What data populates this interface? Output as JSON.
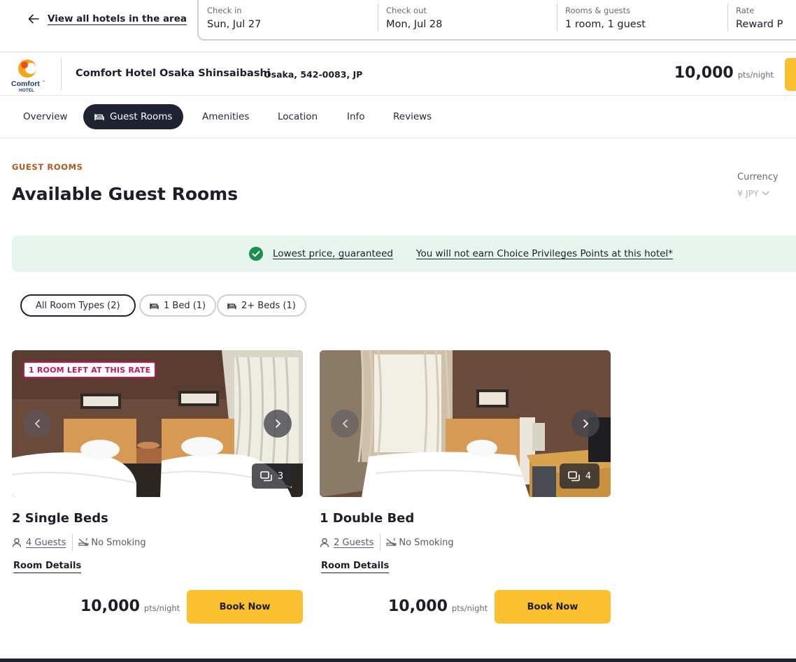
{
  "topbar": {
    "back_label": "View all hotels in the area",
    "fields": [
      {
        "caption": "Check in",
        "value": "Sun, Jul 27"
      },
      {
        "caption": "Check out",
        "value": "Mon, Jul 28"
      },
      {
        "caption": "Rooms & guests",
        "value": "1 room, 1 guest"
      },
      {
        "caption": "Rate",
        "value": "Reward P"
      }
    ]
  },
  "hotel": {
    "logo_text_main": "Comfort",
    "logo_text_tm": "™",
    "logo_text_sub": "HOTEL",
    "name": "Comfort Hotel Osaka Shinsaibashi",
    "address": "Osaka, 542-0083, JP",
    "price": "10,000",
    "price_unit": "pts/night"
  },
  "tabs": [
    {
      "label": "Overview"
    },
    {
      "label": "Guest Rooms",
      "active": true,
      "icon": "bed-icon"
    },
    {
      "label": "Amenities"
    },
    {
      "label": "Location"
    },
    {
      "label": "Info"
    },
    {
      "label": "Reviews"
    }
  ],
  "section": {
    "eyebrow": "GUEST ROOMS",
    "title": "Available Guest Rooms",
    "currency_caption": "Currency",
    "currency_value": "¥ JPY"
  },
  "banner": {
    "link1": "Lowest price, guaranteed",
    "link2": "You will not earn Choice Privileges Points at this hotel*"
  },
  "filters": [
    {
      "label": "All Room Types (2)",
      "active": true
    },
    {
      "label": "1 Bed (1)",
      "icon": "bed-icon"
    },
    {
      "label": "2+ Beds (1)",
      "icon": "bed-icon"
    }
  ],
  "rooms": [
    {
      "badge": "1 ROOM LEFT AT THIS RATE",
      "photo_count": "3",
      "title": "2 Single Beds",
      "guests": "4 Guests",
      "smoking": "No Smoking",
      "details": "Room Details",
      "price": "10,000",
      "price_unit": "pts/night",
      "book": "Book Now"
    },
    {
      "photo_count": "4",
      "title": "1 Double Bed",
      "guests": "2 Guests",
      "smoking": "No Smoking",
      "details": "Room Details",
      "price": "10,000",
      "price_unit": "pts/night",
      "book": "Book Now"
    }
  ],
  "colors": {
    "accent_yellow": "#fbc02d",
    "dark_navy": "#1f2433",
    "eyebrow_orange": "#b4571f",
    "badge_red": "#c2185b",
    "banner_green_bg": "#e8f5ee",
    "check_green": "#1e8e4e"
  }
}
